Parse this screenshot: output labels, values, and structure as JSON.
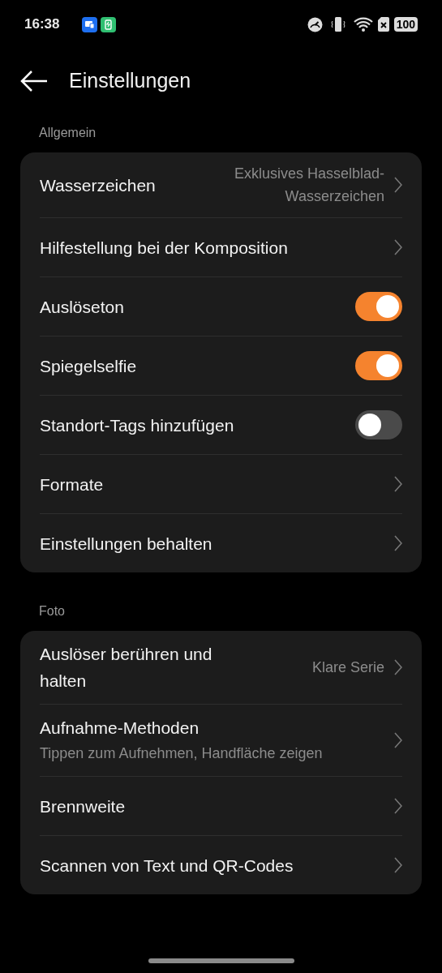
{
  "status_bar": {
    "time": "16:38",
    "battery": "100"
  },
  "header": {
    "title": "Einstellungen"
  },
  "sections": [
    {
      "label": "Allgemein",
      "items": [
        {
          "kind": "link",
          "title": "Wasserzeichen",
          "value": "Exklusives Hasselblad-Wasserzeichen"
        },
        {
          "kind": "link",
          "title": "Hilfestellung bei der Komposition"
        },
        {
          "kind": "toggle",
          "title": "Auslöseton",
          "on": true
        },
        {
          "kind": "toggle",
          "title": "Spiegelselfie",
          "on": true
        },
        {
          "kind": "toggle",
          "title": "Standort-Tags hinzufügen",
          "on": false
        },
        {
          "kind": "link",
          "title": "Formate"
        },
        {
          "kind": "link",
          "title": "Einstellungen behalten"
        }
      ]
    },
    {
      "label": "Foto",
      "items": [
        {
          "kind": "link",
          "title": "Auslöser berühren und halten",
          "value": "Klare Serie"
        },
        {
          "kind": "link",
          "title": "Aufnahme-Methoden",
          "subtitle": "Tippen zum Aufnehmen, Handfläche zeigen"
        },
        {
          "kind": "link",
          "title": "Brennweite"
        },
        {
          "kind": "link",
          "title": "Scannen von Text und QR-Codes"
        }
      ]
    }
  ]
}
